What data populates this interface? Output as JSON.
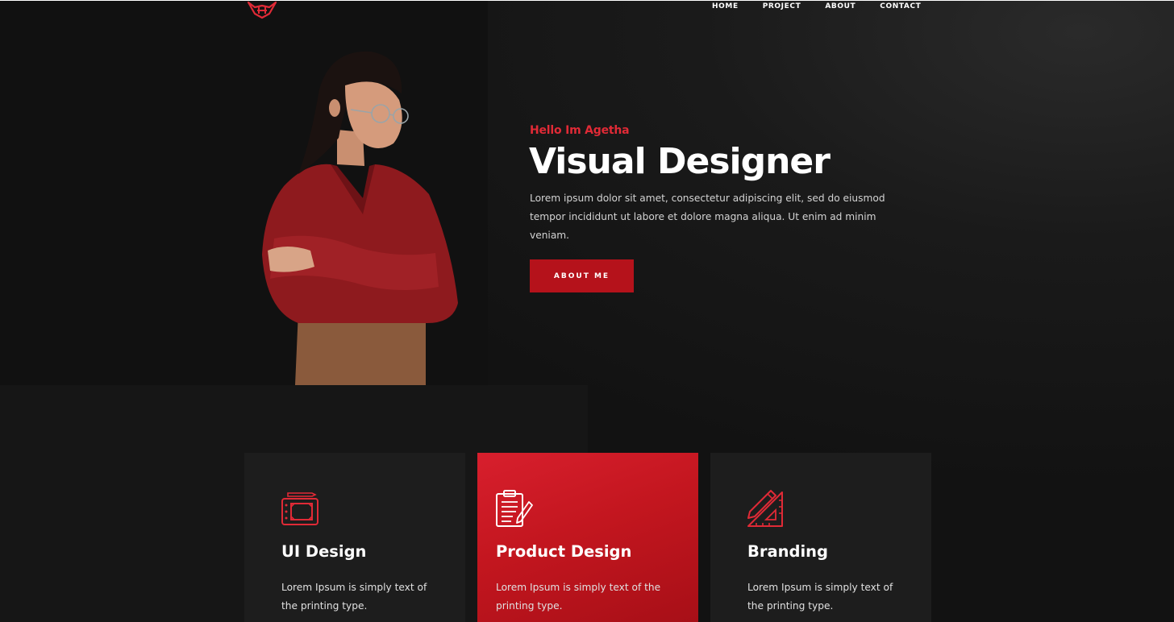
{
  "nav": {
    "items": [
      "HOME",
      "PROJECT",
      "ABOUT",
      "CONTACT"
    ]
  },
  "hero": {
    "greeting": "Hello Im Agetha",
    "headline": "Visual Designer",
    "intro": "Lorem ipsum dolor sit amet, consectetur adipiscing elit, sed do eiusmod tempor incididunt ut labore et dolore magna aliqua. Ut enim ad minim veniam.",
    "cta_label": "ABOUT ME"
  },
  "services": [
    {
      "icon": "design-tablet-icon",
      "title": "UI Design",
      "desc": "Lorem Ipsum is simply text of the printing type."
    },
    {
      "icon": "clipboard-pen-icon",
      "title": "Product Design",
      "desc": "Lorem Ipsum is simply text of the printing type."
    },
    {
      "icon": "pencil-ruler-icon",
      "title": "Branding",
      "desc": "Lorem Ipsum is simply text of the printing type."
    }
  ],
  "colors": {
    "accent": "#e02a36",
    "button": "#b5121b",
    "background": "#141414",
    "card": "#1d1d1d"
  }
}
